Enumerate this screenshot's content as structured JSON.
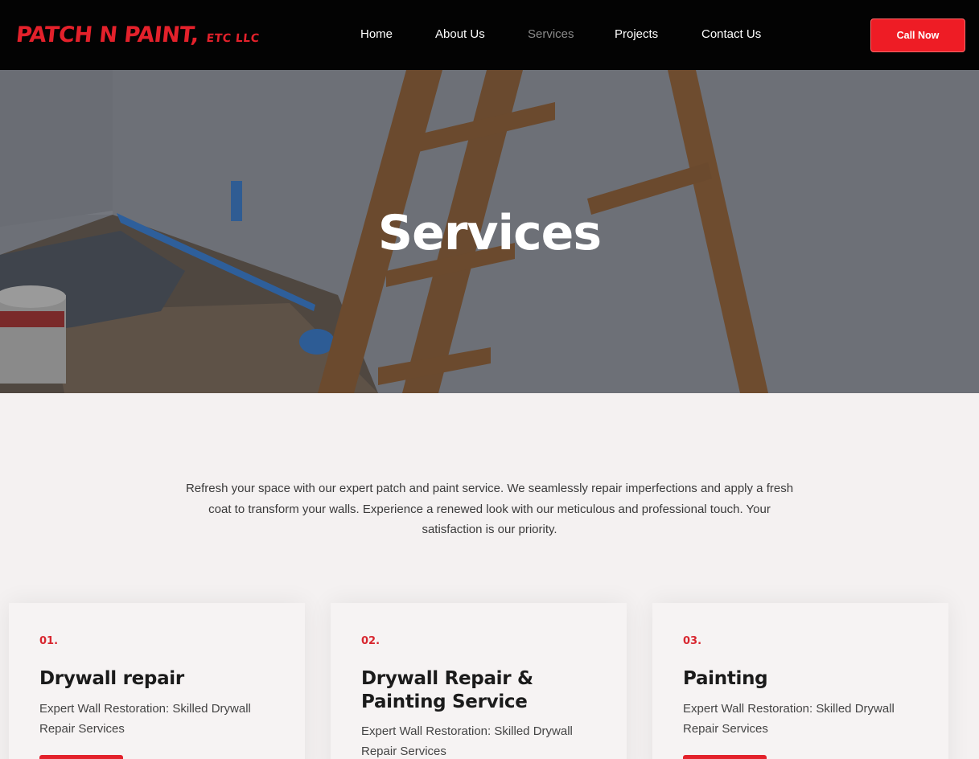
{
  "header": {
    "logo_main": "PATCH N PAINT,",
    "logo_sub": "ETC LLC",
    "nav": {
      "home": "Home",
      "about": "About Us",
      "services": "Services",
      "projects": "Projects",
      "contact": "Contact Us"
    },
    "call_button": "Call Now"
  },
  "hero": {
    "title": "Services"
  },
  "intro": {
    "text": "Refresh your space with our expert patch and paint service. We seamlessly repair imperfections and apply a fresh coat to transform your walls. Experience a renewed look with our meticulous and professional touch. Your satisfaction is our priority."
  },
  "services": [
    {
      "number": "01.",
      "title": "Drywall repair",
      "description": "Expert Wall Restoration: Skilled Drywall Repair Services"
    },
    {
      "number": "02.",
      "title": "Drywall Repair & Painting Service",
      "description": "Expert Wall Restoration: Skilled Drywall Repair Services"
    },
    {
      "number": "03.",
      "title": "Painting",
      "description": "Expert Wall Restoration: Skilled Drywall Repair Services"
    }
  ],
  "colors": {
    "accent": "#ee1c25",
    "header_bg": "#030303",
    "page_bg": "#f4f1f1"
  }
}
